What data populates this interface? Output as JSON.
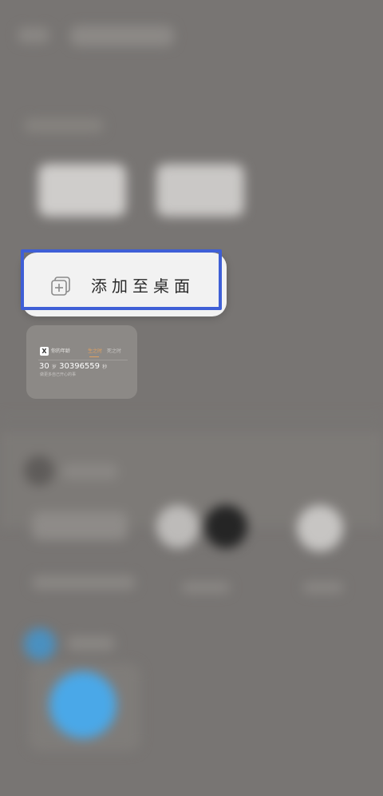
{
  "popup": {
    "add_to_desktop_label": "添加至桌面"
  },
  "widget_preview": {
    "logo_letter": "X",
    "app_name": "你的年龄",
    "tab_active": "生之时",
    "tab_inactive": "死之时",
    "age_years": "30",
    "age_years_unit": "岁",
    "age_seconds": "30396559",
    "age_seconds_unit": "秒",
    "caption": "做更多自己开心的事"
  },
  "colors": {
    "highlight_border": "#3f5fd6",
    "popup_background": "#f2f2f2",
    "tab_active": "#e0a060"
  }
}
